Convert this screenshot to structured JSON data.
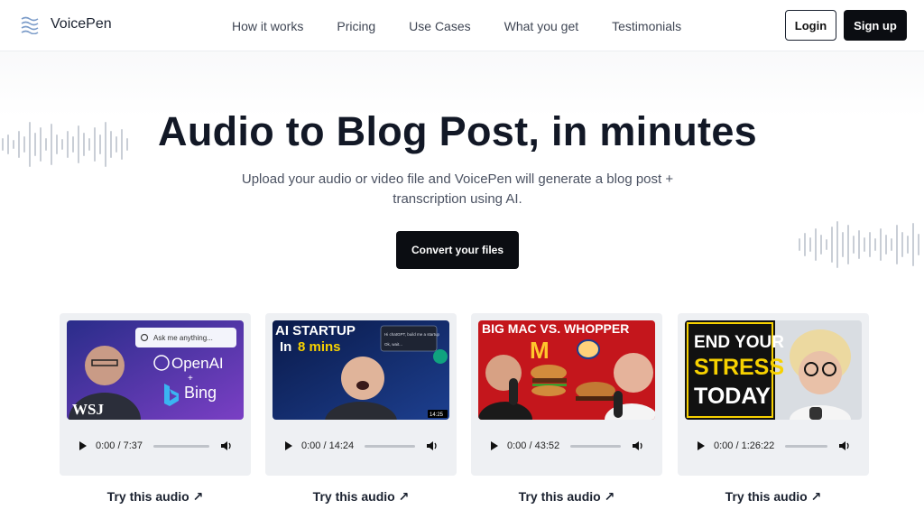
{
  "brand": {
    "name": "VoicePen"
  },
  "nav": [
    "How it works",
    "Pricing",
    "Use Cases",
    "What you get",
    "Testimonials"
  ],
  "auth": {
    "login": "Login",
    "signup": "Sign up"
  },
  "hero": {
    "title": "Audio to Blog Post, in minutes",
    "subtitle": "Upload your audio or video file and VoicePen will generate a blog post + transcription using AI.",
    "cta": "Convert your files"
  },
  "cards": [
    {
      "time": "0:00 / 7:37",
      "try_label": "Try this audio ↗",
      "thumb_text": {
        "search": "Ask me anything...",
        "brand1": "OpenAI",
        "plus": "+",
        "brand2": "Bing",
        "badge": "WSJ"
      }
    },
    {
      "time": "0:00 / 14:24",
      "try_label": "Try this audio ↗",
      "thumb_text": {
        "line1": "AI STARTUP",
        "line2a": "In ",
        "line2b": "8 mins",
        "chat1": "Hi chatGPT, build me a startup",
        "chat2": "Ok, wait...",
        "duration": "14:25"
      }
    },
    {
      "time": "0:00 / 43:52",
      "try_label": "Try this audio ↗",
      "thumb_text": {
        "headline": "BIG MAC VS. WHOPPER",
        "logo_letter": "M"
      }
    },
    {
      "time": "0:00 / 1:26:22",
      "try_label": "Try this audio ↗",
      "thumb_text": {
        "line1": "END YOUR",
        "line2": "STRESS",
        "line3": "TODAY"
      }
    }
  ],
  "colors": {
    "primary_button": "#0b0d12",
    "text": "#121826",
    "card_bg": "#eef0f3"
  }
}
